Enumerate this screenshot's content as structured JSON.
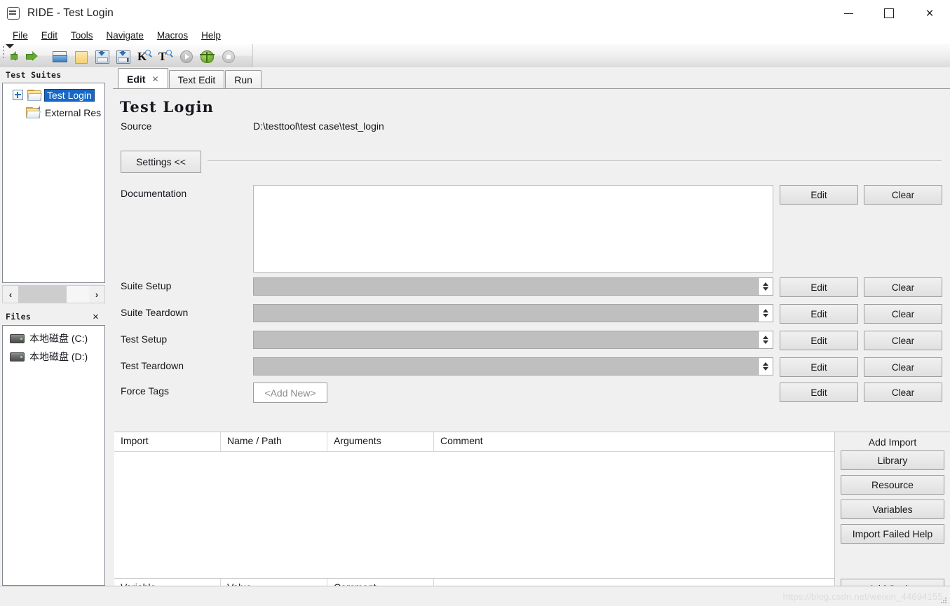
{
  "window": {
    "title": "RIDE - Test Login",
    "app_icon": "robot-icon",
    "minimize_label": "",
    "maximize_label": "",
    "close_label": "×"
  },
  "menubar": [
    {
      "label": "File",
      "mnemonic": "F"
    },
    {
      "label": "Edit",
      "mnemonic": "E"
    },
    {
      "label": "Tools",
      "mnemonic": "T"
    },
    {
      "label": "Navigate",
      "mnemonic": "N"
    },
    {
      "label": "Macros",
      "mnemonic": "M"
    },
    {
      "label": "Help",
      "mnemonic": "H"
    }
  ],
  "toolbar": {
    "buttons": [
      {
        "name": "back-arrow-icon"
      },
      {
        "name": "forward-arrow-icon"
      },
      {
        "name": "open-folder-icon"
      },
      {
        "name": "new-folder-icon"
      },
      {
        "name": "save-icon"
      },
      {
        "name": "save-all-icon"
      },
      {
        "name": "search-keyword-icon",
        "letter": "K"
      },
      {
        "name": "search-test-icon",
        "letter": "T"
      },
      {
        "name": "run-icon"
      },
      {
        "name": "debug-icon"
      },
      {
        "name": "stop-icon"
      }
    ]
  },
  "sidebar": {
    "tree_panel": {
      "title": "Test Suites",
      "items": [
        {
          "label": "Test Login",
          "icon": "folder-open-icon",
          "selected": true,
          "expandable": true
        },
        {
          "label": "External Res",
          "icon": "folder-resource-icon",
          "selected": false,
          "expandable": false
        }
      ],
      "hscroll": {
        "left_arrow": "‹",
        "right_arrow": "›"
      }
    },
    "files_panel": {
      "title": "Files",
      "close_label": "✕",
      "items": [
        {
          "label": "本地磁盘 (C:)",
          "icon": "drive-icon"
        },
        {
          "label": "本地磁盘 (D:)",
          "icon": "drive-icon"
        }
      ]
    }
  },
  "editor": {
    "tabs": [
      {
        "label": "Edit",
        "active": true,
        "closable": true,
        "close_label": "✕"
      },
      {
        "label": "Text Edit",
        "active": false,
        "closable": false
      },
      {
        "label": "Run",
        "active": false,
        "closable": false
      }
    ],
    "suite_title": "Test Login",
    "source": {
      "label": "Source",
      "value": "D:\\testtool\\test case\\test_login"
    },
    "settings_toggle": "Settings <<",
    "fields": [
      {
        "label": "Documentation",
        "type": "textarea",
        "value": "",
        "edit_label": "Edit",
        "clear_label": "Clear"
      },
      {
        "label": "Suite Setup",
        "type": "combo",
        "value": "",
        "edit_label": "Edit",
        "clear_label": "Clear"
      },
      {
        "label": "Suite Teardown",
        "type": "combo",
        "value": "",
        "edit_label": "Edit",
        "clear_label": "Clear"
      },
      {
        "label": "Test Setup",
        "type": "combo",
        "value": "",
        "edit_label": "Edit",
        "clear_label": "Clear"
      },
      {
        "label": "Test Teardown",
        "type": "combo",
        "value": "",
        "edit_label": "Edit",
        "clear_label": "Clear"
      },
      {
        "label": "Force Tags",
        "type": "tags",
        "add_new_label": "<Add New>",
        "edit_label": "Edit",
        "clear_label": "Clear"
      }
    ],
    "import_grid": {
      "columns": [
        "Import",
        "Name / Path",
        "Arguments",
        "Comment"
      ],
      "rows": []
    },
    "variable_grid": {
      "columns": [
        "Variable",
        "Value",
        "Comment",
        ""
      ],
      "rows": []
    },
    "side_panel": {
      "import_title": "Add Import",
      "import_buttons": [
        "Library",
        "Resource",
        "Variables",
        "Import Failed Help"
      ],
      "variable_buttons": [
        "Add Scalar"
      ]
    }
  },
  "watermark": "https://blog.csdn.net/weixin_44694155"
}
